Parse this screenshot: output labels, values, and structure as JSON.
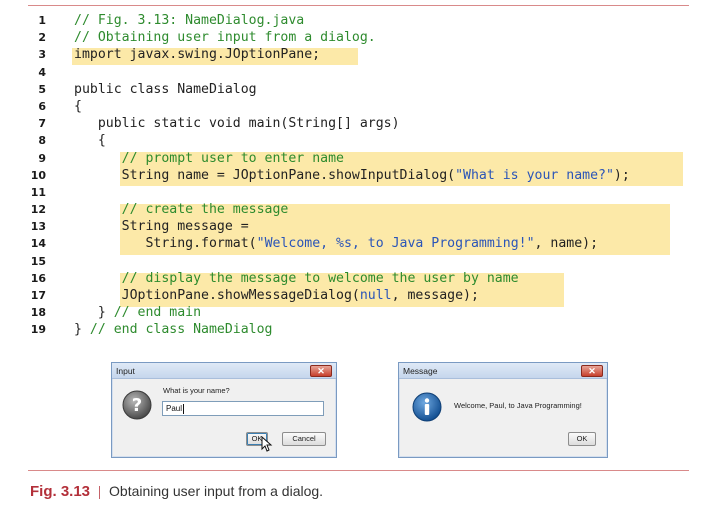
{
  "listing": {
    "lines": [
      {
        "num": "1",
        "code": "// Fig. 3.13: NameDialog.java"
      },
      {
        "num": "2",
        "code": "// Obtaining user input from a dialog."
      },
      {
        "num": "3",
        "code": "import javax.swing.JOptionPane;"
      },
      {
        "num": "4",
        "code": ""
      },
      {
        "num": "5",
        "code": "public class NameDialog"
      },
      {
        "num": "6",
        "code": "{"
      },
      {
        "num": "7",
        "code": "   public static void main(String[] args)"
      },
      {
        "num": "8",
        "code": "   {"
      },
      {
        "num": "9",
        "code": "      // prompt user to enter name"
      },
      {
        "num": "10",
        "code": "      String name = JOptionPane.showInputDialog(\"What is your name?\");"
      },
      {
        "num": "11",
        "code": ""
      },
      {
        "num": "12",
        "code": "      // create the message"
      },
      {
        "num": "13",
        "code": "      String message ="
      },
      {
        "num": "14",
        "code": "         String.format(\"Welcome, %s, to Java Programming!\", name);"
      },
      {
        "num": "15",
        "code": ""
      },
      {
        "num": "16",
        "code": "      // display the message to welcome the user by name"
      },
      {
        "num": "17",
        "code": "      JOptionPane.showMessageDialog(null, message);"
      },
      {
        "num": "18",
        "code": "   } // end main"
      },
      {
        "num": "19",
        "code": "} // end class NameDialog"
      }
    ]
  },
  "input_dialog": {
    "title": "Input",
    "prompt": "What is your name?",
    "value": "Paul",
    "ok_label": "OK",
    "cancel_label": "Cancel",
    "icon": "question-icon"
  },
  "message_dialog": {
    "title": "Message",
    "message": "Welcome, Paul, to Java Programming!",
    "ok_label": "OK",
    "icon": "info-icon"
  },
  "caption": {
    "label": "Fig. 3.13",
    "separator": "|",
    "text": "Obtaining user input from a dialog."
  },
  "colors": {
    "highlight": "#fce9a8",
    "comment": "#2e8b2e",
    "string": "#2b55b8",
    "caption_accent": "#b3303a"
  }
}
